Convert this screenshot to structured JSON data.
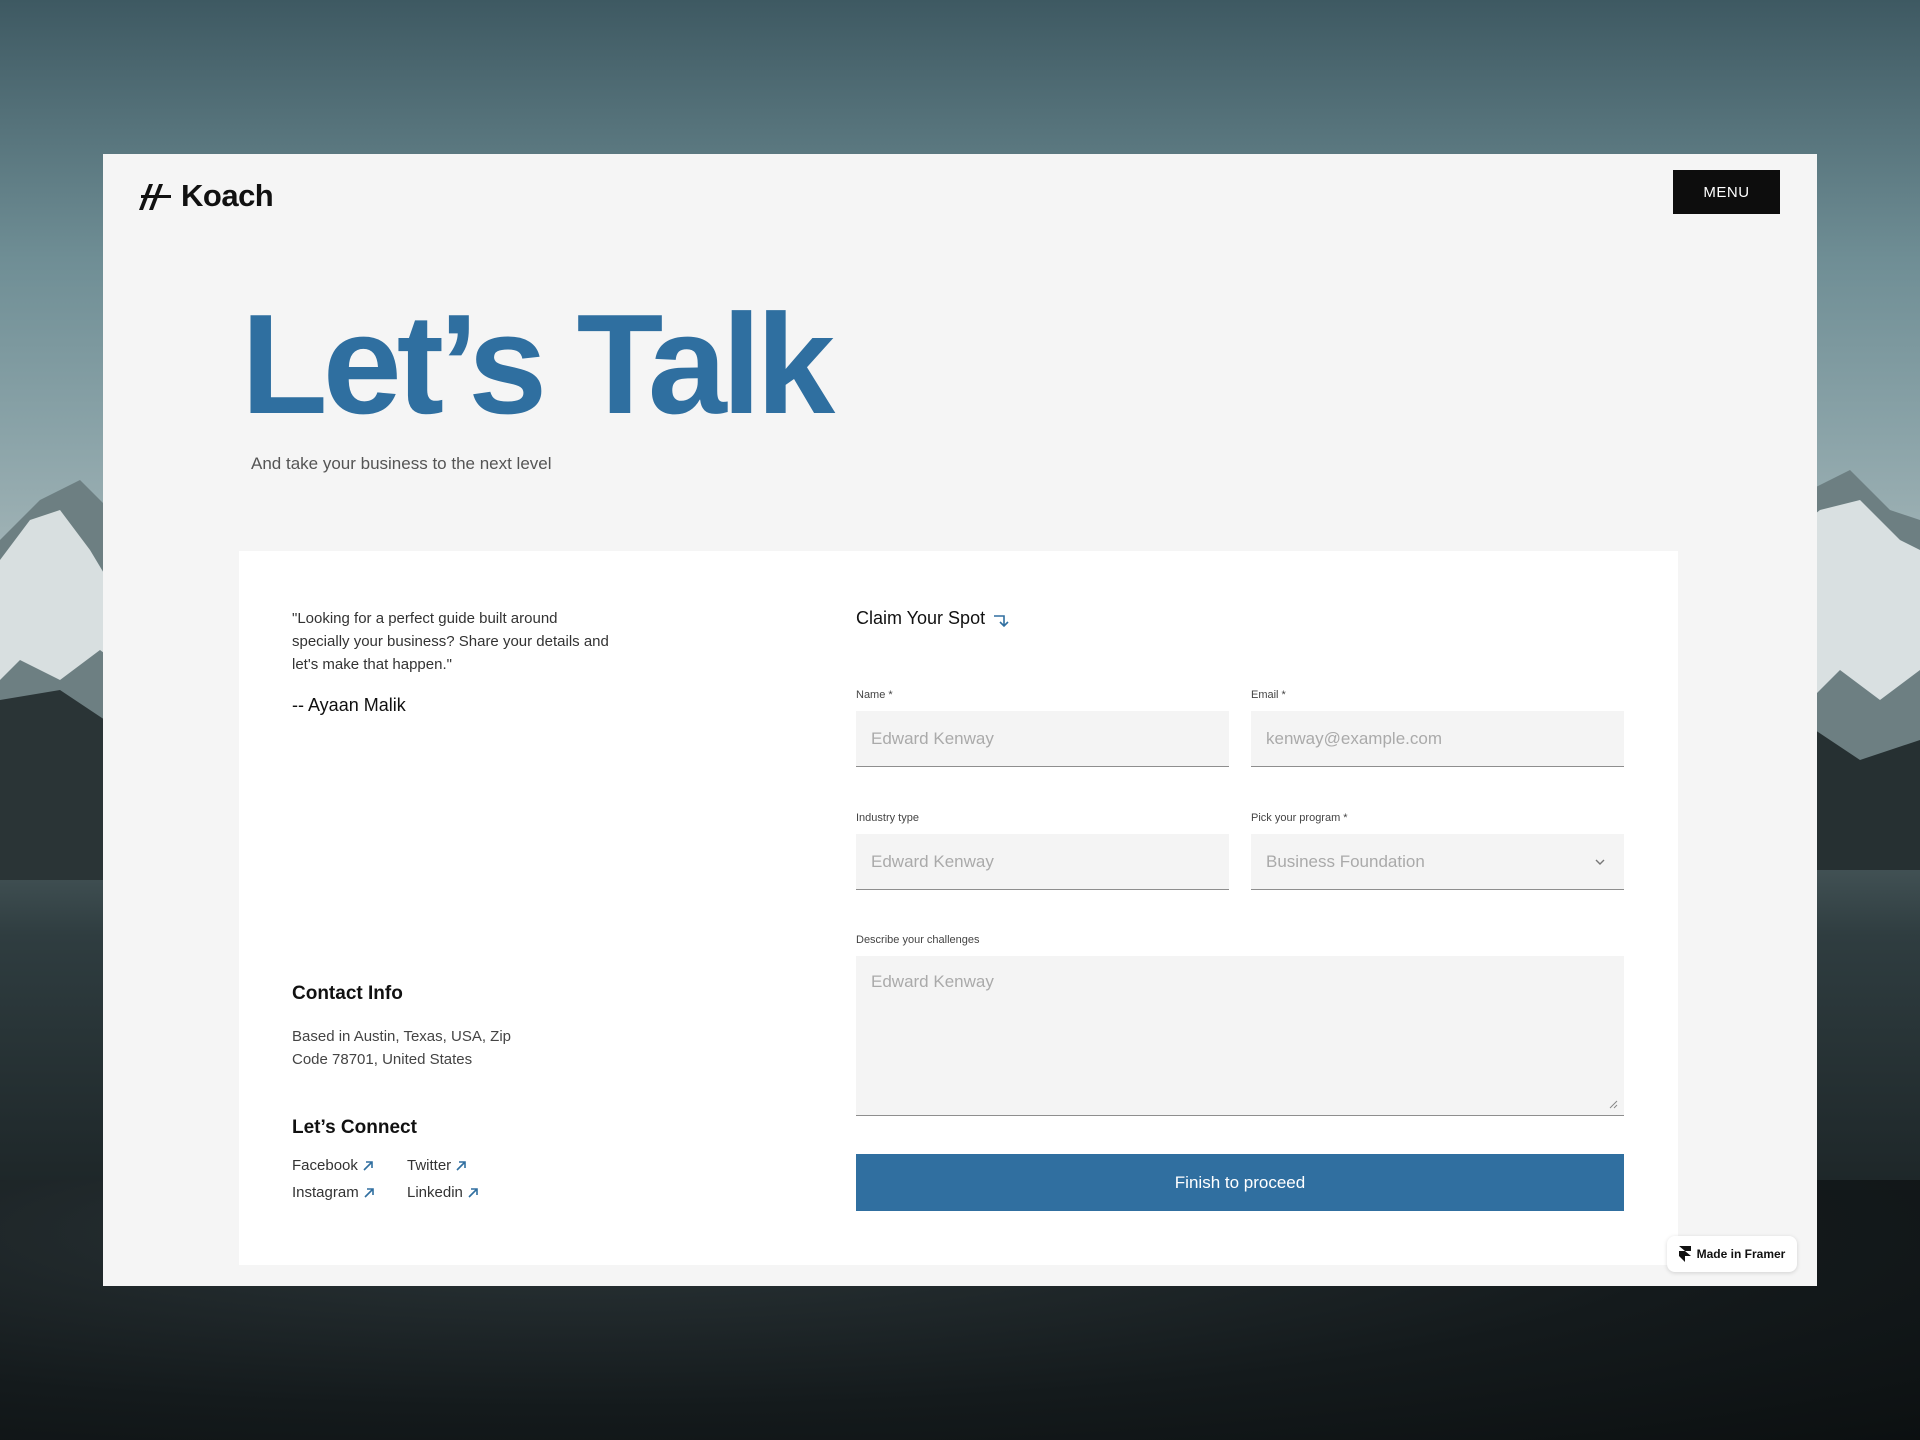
{
  "header": {
    "logo_text": "Koach",
    "menu_label": "MENU"
  },
  "hero": {
    "title": "Let’s Talk",
    "subtitle": "And take your business to the next level"
  },
  "testimonial": {
    "quote": "\"Looking for a perfect guide built around specially your business? Share your details and let's make that happen.\"",
    "author": "-- Ayaan Malik"
  },
  "contact": {
    "heading": "Contact Info",
    "address": "Based in Austin, Texas, USA, Zip Code 78701, United States"
  },
  "connect": {
    "heading": "Let’s Connect",
    "links": [
      {
        "label": "Facebook"
      },
      {
        "label": "Twitter"
      },
      {
        "label": "Instagram"
      },
      {
        "label": "Linkedin"
      }
    ]
  },
  "form": {
    "title": "Claim Your Spot",
    "name": {
      "label": "Name *",
      "placeholder": "Edward Kenway"
    },
    "email": {
      "label": "Email *",
      "placeholder": "kenway@example.com"
    },
    "industry": {
      "label": "Industry type",
      "placeholder": "Edward Kenway"
    },
    "program": {
      "label": "Pick your program *",
      "selected": "Business Foundation"
    },
    "challenges": {
      "label": "Describe your challenges",
      "placeholder": "Edward Kenway"
    },
    "submit_label": "Finish to proceed"
  },
  "badge": {
    "label": "Made in Framer"
  },
  "colors": {
    "accent": "#306fa0",
    "menu_bg": "#0d0d0d",
    "page_bg": "#f5f5f5"
  }
}
